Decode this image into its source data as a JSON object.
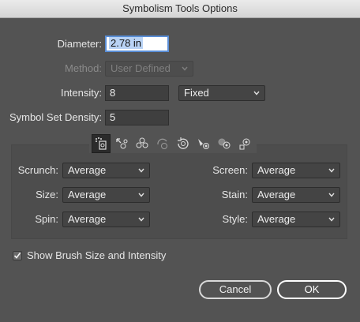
{
  "window": {
    "title": "Symbolism Tools Options"
  },
  "diameter": {
    "label": "Diameter:",
    "value": "2.78 in"
  },
  "method": {
    "label": "Method:",
    "value": "User Defined"
  },
  "intensity": {
    "label": "Intensity:",
    "value": "8",
    "mode": "Fixed"
  },
  "density": {
    "label": "Symbol Set Density:",
    "value": "5"
  },
  "tools": [
    {
      "name": "sprayer"
    },
    {
      "name": "shifter"
    },
    {
      "name": "scruncher"
    },
    {
      "name": "sizer"
    },
    {
      "name": "spinner"
    },
    {
      "name": "stainer"
    },
    {
      "name": "screener"
    },
    {
      "name": "styler"
    }
  ],
  "options": {
    "scrunch": {
      "label": "Scrunch:",
      "value": "Average"
    },
    "size": {
      "label": "Size:",
      "value": "Average"
    },
    "spin": {
      "label": "Spin:",
      "value": "Average"
    },
    "screen": {
      "label": "Screen:",
      "value": "Average"
    },
    "stain": {
      "label": "Stain:",
      "value": "Average"
    },
    "style": {
      "label": "Style:",
      "value": "Average"
    }
  },
  "show_brush": {
    "label": "Show Brush Size and Intensity",
    "checked": true
  },
  "buttons": {
    "cancel": "Cancel",
    "ok": "OK"
  }
}
